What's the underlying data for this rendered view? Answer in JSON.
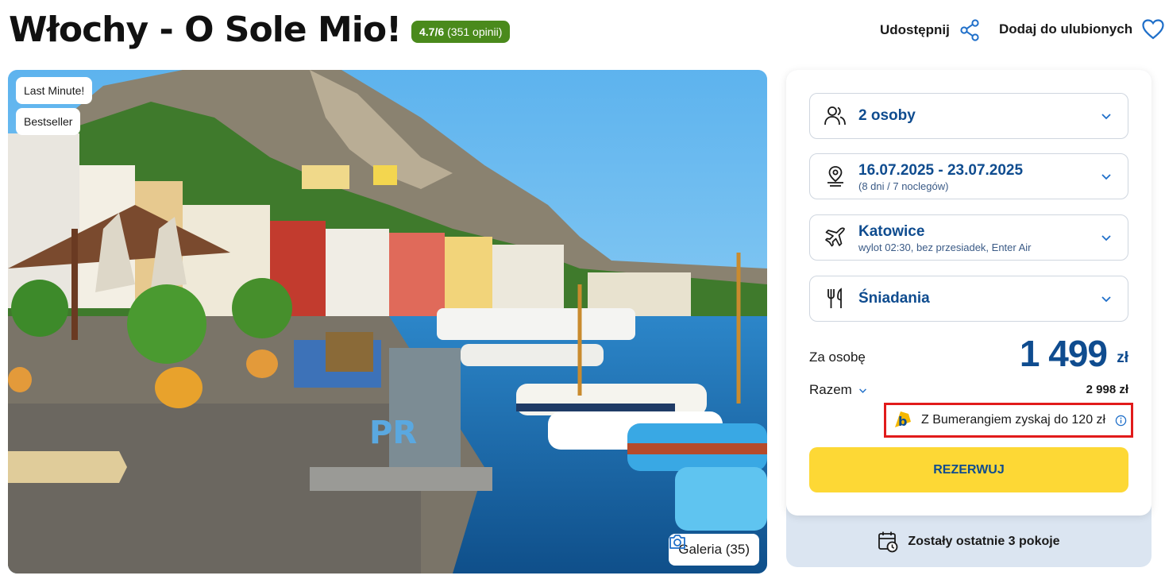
{
  "header": {
    "title": "Włochy - O Sole Mio!",
    "rating_score": "4.7/6",
    "rating_reviews": "(351 opinii)",
    "share_label": "Udostępnij",
    "favorite_label": "Dodaj do ulubionych"
  },
  "photo": {
    "badges": [
      "Last Minute!",
      "Bestseller"
    ],
    "gallery_label": "Galeria (35)"
  },
  "booking": {
    "guests": "2 osoby",
    "dates": "16.07.2025 - 23.07.2025",
    "dates_sub": "(8 dni / 7 noclegów)",
    "departure": "Katowice",
    "departure_sub": "wylot 02:30, bez przesiadek, Enter Air",
    "board": "Śniadania",
    "per_person_label": "Za osobę",
    "price": "1 499",
    "currency": "zł",
    "total_label": "Razem",
    "total_value": "2 998 zł",
    "bumerang_text": "Z Bumerangiem zyskaj do 120 zł",
    "reserve_label": "REZERWUJ",
    "rooms_left": "Zostały ostatnie 3 pokoje"
  },
  "colors": {
    "brand_blue": "#0f4c8f",
    "rating_green": "#4a8a1c",
    "reserve_yellow": "#fdd835",
    "highlight_red": "#e11b1b"
  },
  "icons": [
    "share-icon",
    "heart-icon",
    "camera-icon",
    "people-icon",
    "calendar-pin-icon",
    "plane-icon",
    "cutlery-icon",
    "chevron-down-icon",
    "bumerang-logo-icon",
    "info-icon",
    "calendar-clock-icon"
  ]
}
